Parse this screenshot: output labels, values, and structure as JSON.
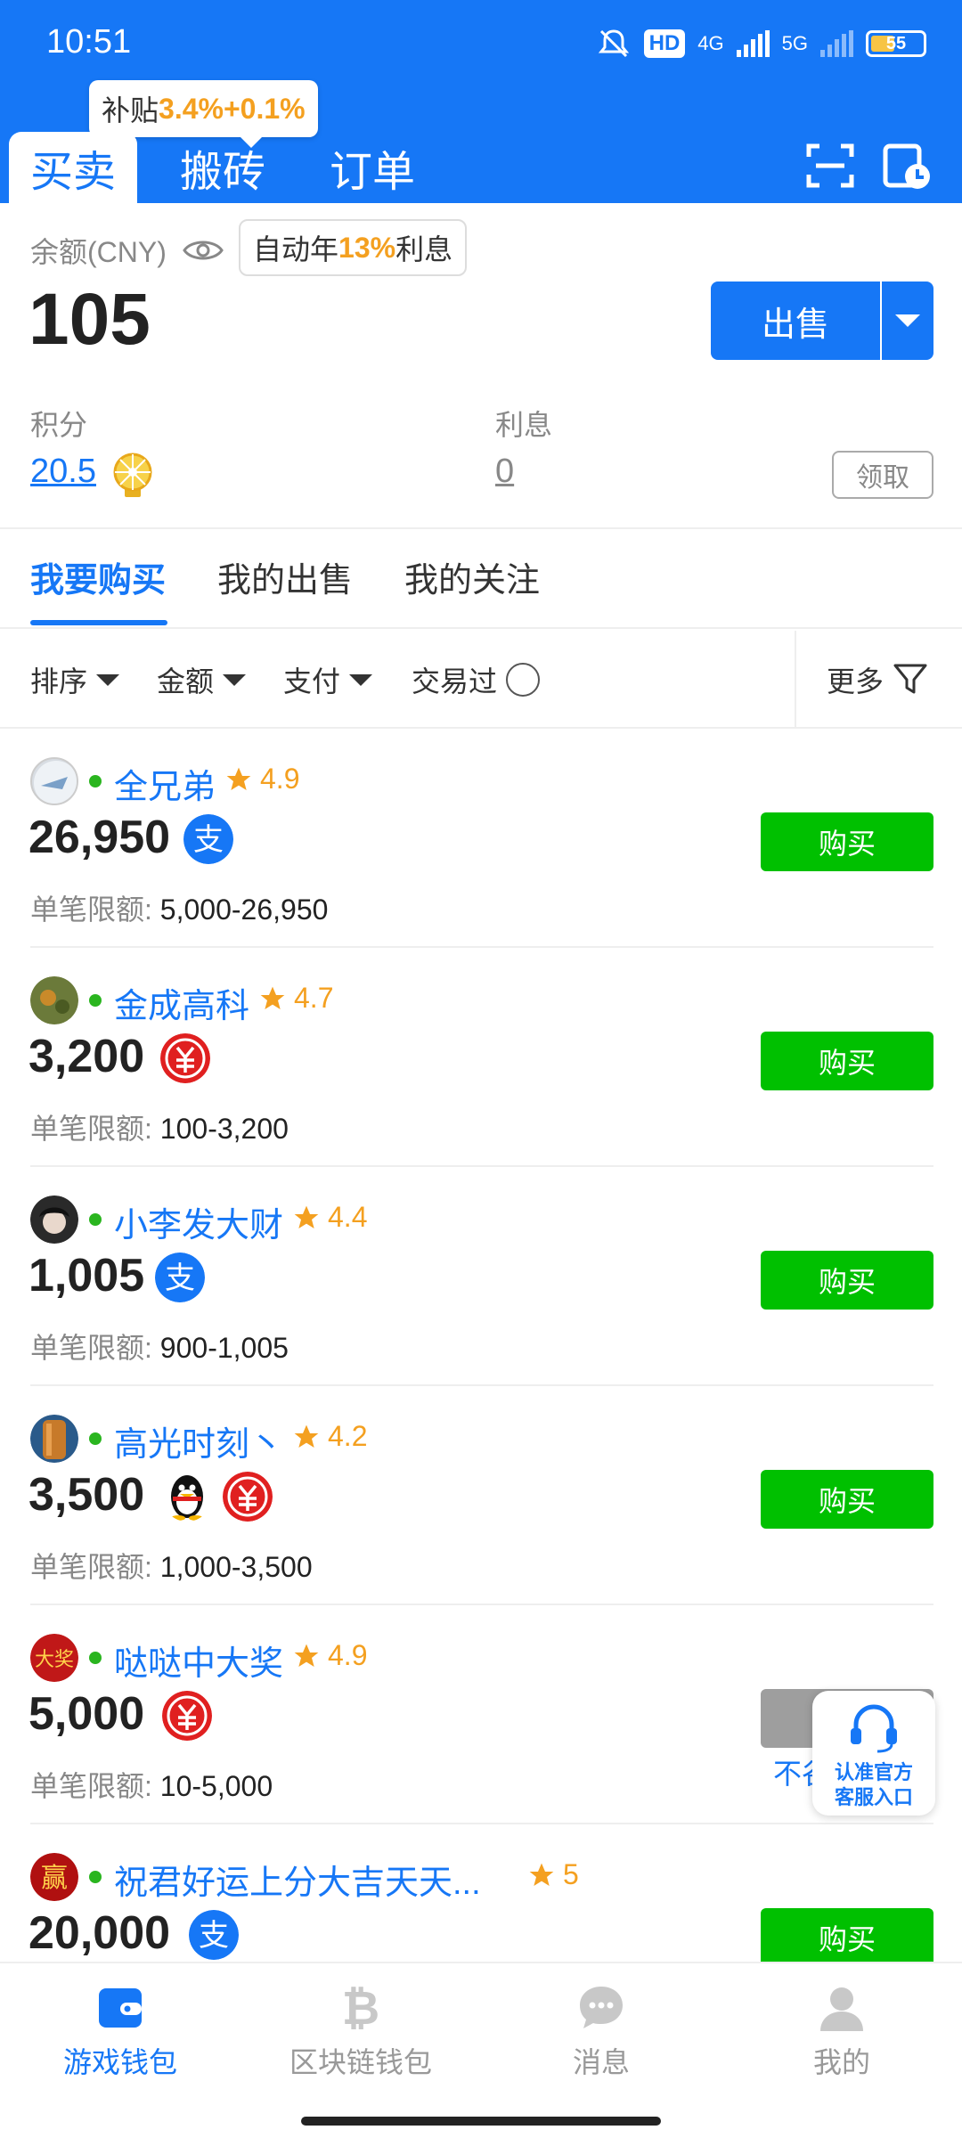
{
  "status": {
    "time": "10:51",
    "hd": "HD",
    "net1": "4G",
    "net2": "5G",
    "battery": "55"
  },
  "header": {
    "subsidy_prefix": "补贴",
    "subsidy_value": "3.4%+0.1%",
    "tabs": [
      "买卖",
      "搬砖",
      "订单"
    ]
  },
  "balance": {
    "label": "余额(CNY)",
    "value": "105",
    "interest_tip_prefix": "自动年",
    "interest_tip_rate": "13%",
    "interest_tip_suffix": "利息",
    "sell_label": "出售"
  },
  "points": {
    "label": "积分",
    "value": "20.5"
  },
  "interest": {
    "label": "利息",
    "value": "0",
    "claim_label": "领取"
  },
  "sub_tabs": [
    "我要购买",
    "我的出售",
    "我的关注"
  ],
  "filters": {
    "sort": "排序",
    "amount": "金额",
    "pay": "支付",
    "traded": "交易过",
    "more": "更多"
  },
  "listings": [
    {
      "name": "全兄弟",
      "rating": "4.9",
      "amount": "26,950",
      "limit_label": "单笔限额:",
      "limit": "5,000-26,950",
      "buy": "购买",
      "pay": [
        "alipay"
      ]
    },
    {
      "name": "金成高科",
      "rating": "4.7",
      "amount": "3,200",
      "limit_label": "单笔限额:",
      "limit": "100-3,200",
      "buy": "购买",
      "pay": [
        "unionpay"
      ]
    },
    {
      "name": "小李发大财",
      "rating": "4.4",
      "amount": "1,005",
      "limit_label": "单笔限额:",
      "limit": "900-1,005",
      "buy": "购买",
      "pay": [
        "alipay"
      ]
    },
    {
      "name": "高光时刻丶",
      "rating": "4.2",
      "amount": "3,500",
      "limit_label": "单笔限额:",
      "limit": "1,000-3,500",
      "buy": "购买",
      "pay": [
        "qq",
        "unionpay"
      ]
    },
    {
      "name": "哒哒中大奖",
      "rating": "4.9",
      "amount": "5,000",
      "limit_label": "单笔限额:",
      "limit": "10-5,000",
      "buy": "",
      "pay": [
        "unionpay"
      ]
    },
    {
      "name": "祝君好运上分大吉天天...",
      "rating": "5",
      "amount": "20,000",
      "limit_label": "",
      "limit": "",
      "buy": "购买",
      "pay": [
        "alipay"
      ]
    }
  ],
  "overlay": {
    "not_label": "不谷",
    "cs_line1": "认准官方",
    "cs_line2": "客服入口"
  },
  "nav": [
    "游戏钱包",
    "区块链钱包",
    "消息",
    "我的"
  ],
  "colors": {
    "primary": "#1677f6",
    "buy": "#00c000",
    "accent": "#f4a020"
  },
  "icons": [
    "scan-icon",
    "order-history-icon",
    "eye-icon",
    "alipay-icon",
    "unionpay-icon",
    "qq-icon",
    "star-icon",
    "filter-icon",
    "headset-icon",
    "wallet-icon",
    "bitcoin-icon",
    "chat-icon",
    "user-icon"
  ]
}
